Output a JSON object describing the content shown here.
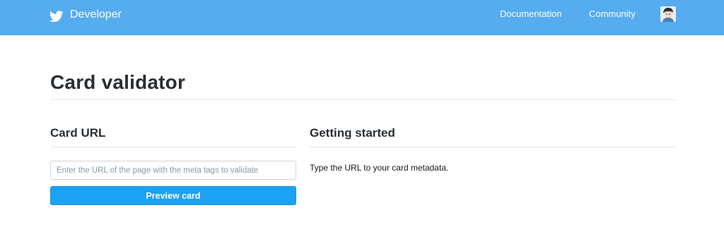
{
  "header": {
    "brand_label": "Developer",
    "brand_icon": "twitter-bird-icon",
    "nav": [
      {
        "label": "Documentation"
      },
      {
        "label": "Community"
      }
    ],
    "avatar_icon": "user-avatar",
    "colors": {
      "bar": "#55acee",
      "text": "#ffffff"
    }
  },
  "page": {
    "title": "Card validator"
  },
  "card_url": {
    "heading": "Card URL",
    "input_value": "",
    "input_placeholder": "Enter the URL of the page with the meta tags to validate",
    "button_label": "Preview card",
    "button_color": "#1da1f2"
  },
  "getting_started": {
    "heading": "Getting started",
    "text": "Type the URL to your card metadata."
  }
}
